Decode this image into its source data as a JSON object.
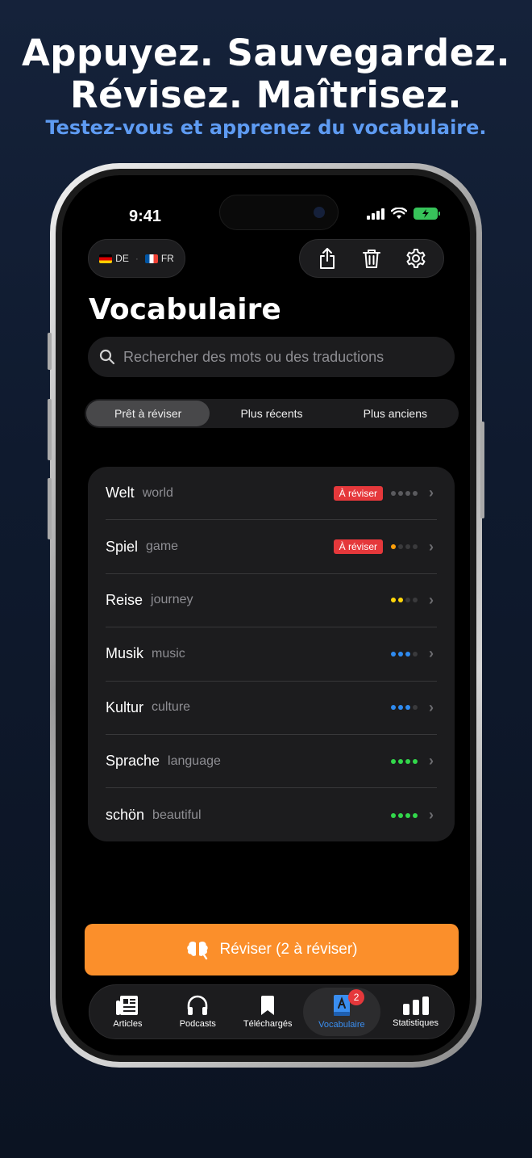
{
  "promo": {
    "headline_line1": "Appuyez. Sauvegardez.",
    "headline_line2": "Révisez. Maîtrisez.",
    "subtitle": "Testez-vous et apprenez du vocabulaire."
  },
  "status_bar": {
    "time": "9:41"
  },
  "language": {
    "source": "DE",
    "target": "FR"
  },
  "header": {
    "title": "Vocabulaire",
    "actions": [
      "share-icon",
      "trash-icon",
      "gear-icon"
    ]
  },
  "search": {
    "placeholder": "Rechercher des mots ou des traductions"
  },
  "segments": {
    "items": [
      "Prêt à réviser",
      "Plus récents",
      "Plus anciens"
    ],
    "selected": 0
  },
  "colors": {
    "accent": "#fb8f2b",
    "badge": "#e5383b",
    "level_orange": "#ff9f0a",
    "level_yellow": "#ffd60a",
    "level_blue": "#2f8bf0",
    "level_green": "#32d74b",
    "active_tab": "#3a8ef0"
  },
  "vocab": [
    {
      "word": "Welt",
      "translation": "world",
      "badge": "À réviser",
      "level": 0,
      "level_color": "#5a5a5e"
    },
    {
      "word": "Spiel",
      "translation": "game",
      "badge": "À réviser",
      "level": 1,
      "level_color": "#ff9f0a"
    },
    {
      "word": "Reise",
      "translation": "journey",
      "badge": "",
      "level": 2,
      "level_color": "#ffd60a"
    },
    {
      "word": "Musik",
      "translation": "music",
      "badge": "",
      "level": 3,
      "level_color": "#2f8bf0"
    },
    {
      "word": "Kultur",
      "translation": "culture",
      "badge": "",
      "level": 3,
      "level_color": "#2f8bf0"
    },
    {
      "word": "Sprache",
      "translation": "language",
      "badge": "",
      "level": 4,
      "level_color": "#32d74b"
    },
    {
      "word": "schön",
      "translation": "beautiful",
      "badge": "",
      "level": 4,
      "level_color": "#32d74b"
    }
  ],
  "review_button": {
    "label": "Réviser (2 à réviser)"
  },
  "tabs": [
    {
      "label": "Articles",
      "icon": "newspaper-icon"
    },
    {
      "label": "Podcasts",
      "icon": "headphones-icon"
    },
    {
      "label": "Téléchargés",
      "icon": "bookmark-icon"
    },
    {
      "label": "Vocabulaire",
      "icon": "dictionary-icon",
      "badge": "2",
      "active": true
    },
    {
      "label": "Statistiques",
      "icon": "bar-chart-icon"
    }
  ]
}
